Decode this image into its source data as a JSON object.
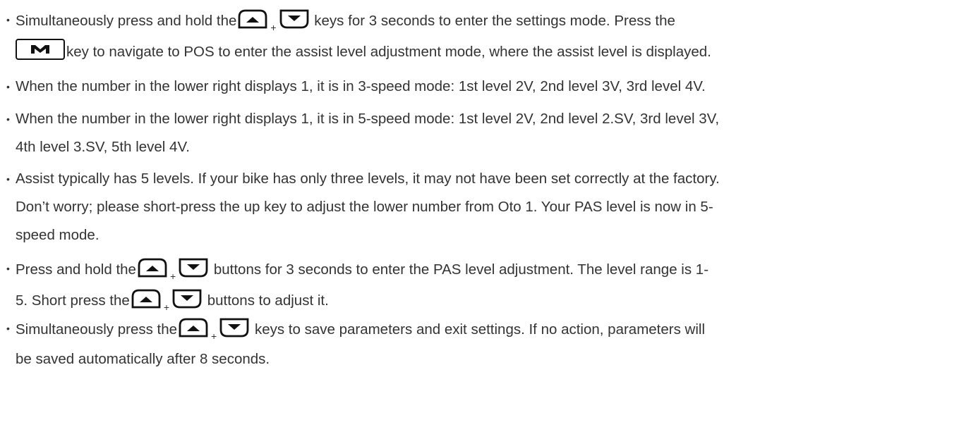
{
  "bullets": [
    {
      "lines": [
        {
          "pre": "Simultaneously press and hold the",
          "post": "keys for 3 seconds to enter the settings mode. Press the"
        },
        {
          "post": "key to navigate to POS to enter the assist level adjustment mode, where the assist level is displayed."
        }
      ]
    },
    {
      "lines": [
        {
          "text": "When the number in the lower right displays 1, it is in 3-speed mode: 1st level 2V, 2nd level 3V, 3rd level 4V."
        }
      ]
    },
    {
      "lines": [
        {
          "text": "When the number in the lower right displays 1, it is in 5-speed mode: 1st level 2V, 2nd level 2.SV, 3rd level 3V,"
        },
        {
          "text": "4th level 3.SV, 5th level 4V."
        }
      ]
    },
    {
      "lines": [
        {
          "text": "Assist typically has 5 levels. If your bike has only three levels, it may not have been set correctly at the factory."
        },
        {
          "text": "Don’t worry; please short-press the up key to adjust the lower number from Oto 1. Your PAS level is now in 5-"
        },
        {
          "text": "speed mode."
        }
      ]
    },
    {
      "lines": [
        {
          "pre": "Press and hold the",
          "post": "buttons for 3 seconds to enter the PAS level adjustment. The level range is 1-"
        },
        {
          "pre": "5. Short press the",
          "post": "buttons to adjust it."
        }
      ]
    },
    {
      "lines": [
        {
          "pre": "Simultaneously press the",
          "post": "keys to save parameters and exit settings. If no action, parameters will"
        },
        {
          "text": "be saved automatically after 8 seconds."
        }
      ]
    }
  ],
  "bullet_glyph": "•",
  "plus_sign": "+",
  "icons": {
    "up": "up-key-icon",
    "down": "down-key-icon",
    "mode": "m-key-icon"
  },
  "colors": {
    "text": "#333333",
    "icon": "#111111",
    "background": "#ffffff"
  }
}
